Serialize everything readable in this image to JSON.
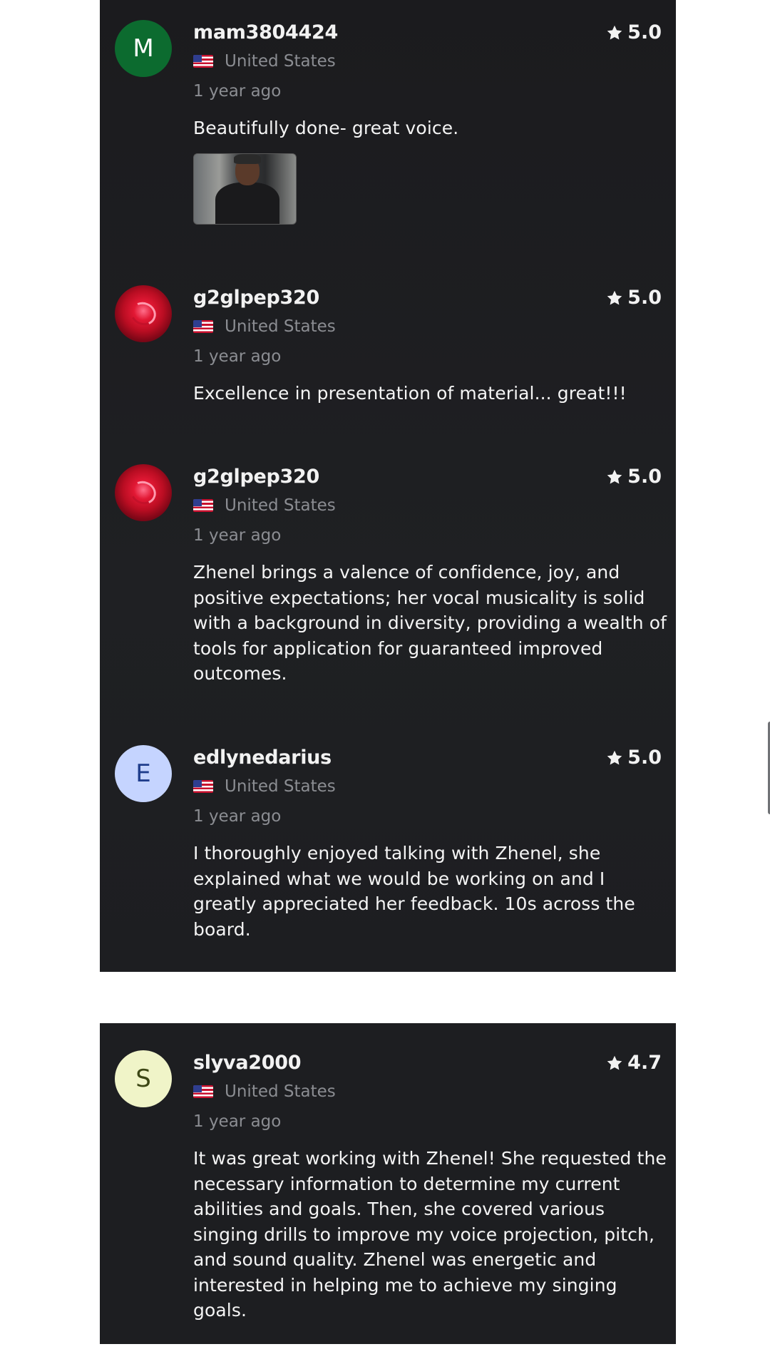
{
  "reviews": [
    {
      "username": "mam3804424",
      "avatar_letter": "M",
      "country": "United States",
      "time": "1 year ago",
      "rating": "5.0",
      "text": "Beautifully done- great voice."
    },
    {
      "username": "g2glpep320",
      "country": "United States",
      "time": "1 year ago",
      "rating": "5.0",
      "text": "Excellence in presentation of material... great!!!"
    },
    {
      "username": "g2glpep320",
      "country": "United States",
      "time": "1 year ago",
      "rating": "5.0",
      "text": "Zhenel brings a valence of confidence, joy, and positive expectations; her vocal musicality is solid with a background in diversity, providing a wealth of tools for application for guaranteed improved outcomes."
    },
    {
      "username": "edlynedarius",
      "avatar_letter": "E",
      "country": "United States",
      "time": "1 year ago",
      "rating": "5.0",
      "text": "I thoroughly enjoyed talking with Zhenel, she explained what we would be working on and I greatly appreciated her feedback. 10s across the board."
    },
    {
      "username": "slyva2000",
      "avatar_letter": "S",
      "country": "United States",
      "time": "1 year ago",
      "rating": "4.7",
      "text": "It was great working with Zhenel! She requested the necessary information to determine my current abilities and goals. Then, she covered various singing drills to improve my voice projection, pitch, and sound quality. Zhenel was energetic and interested in helping me to achieve my singing goals."
    }
  ],
  "colors": {
    "panel_bg": "#1d1e21",
    "text_primary": "#f2f2f2",
    "text_secondary": "#8b8d92"
  },
  "icons": [
    "star-icon",
    "us-flag-icon"
  ]
}
